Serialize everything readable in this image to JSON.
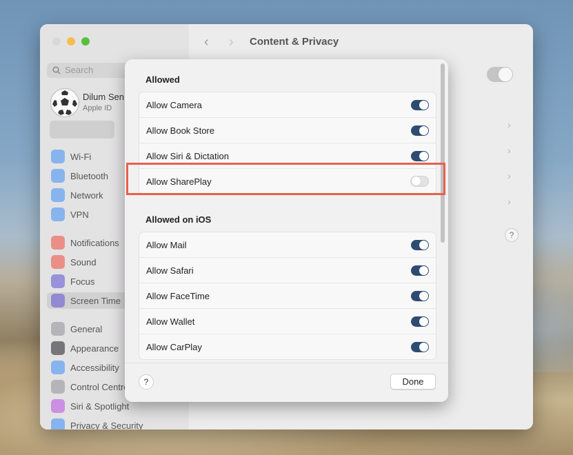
{
  "window": {
    "title": "Content & Privacy",
    "search_placeholder": "Search",
    "profile": {
      "name": "Dilum Sen",
      "subtitle": "Apple ID"
    },
    "sidebar": [
      {
        "label": "Wi-Fi",
        "icon": "wifi-icon",
        "color": "#3a8ef6"
      },
      {
        "label": "Bluetooth",
        "icon": "bluetooth-icon",
        "color": "#3a8ef6"
      },
      {
        "label": "Network",
        "icon": "globe-icon",
        "color": "#3a8ef6"
      },
      {
        "label": "VPN",
        "icon": "vpn-icon",
        "color": "#3a8ef6"
      },
      {
        "label": "Notifications",
        "icon": "bell-icon",
        "color": "#ef4a3c"
      },
      {
        "label": "Sound",
        "icon": "speaker-icon",
        "color": "#ef4a3c"
      },
      {
        "label": "Focus",
        "icon": "moon-icon",
        "color": "#5b4fcf"
      },
      {
        "label": "Screen Time",
        "icon": "hourglass-icon",
        "color": "#5b4fcf",
        "selected": true
      },
      {
        "label": "General",
        "icon": "gear-icon",
        "color": "#8e8e93"
      },
      {
        "label": "Appearance",
        "icon": "appearance-icon",
        "color": "#1c1c1e"
      },
      {
        "label": "Accessibility",
        "icon": "accessibility-icon",
        "color": "#3a8ef6"
      },
      {
        "label": "Control Centre",
        "icon": "control-centre-icon",
        "color": "#8e8e93"
      },
      {
        "label": "Siri & Spotlight",
        "icon": "siri-icon",
        "color": "#b84ce0"
      },
      {
        "label": "Privacy & Security",
        "icon": "hand-icon",
        "color": "#3a8ef6"
      }
    ]
  },
  "sheet": {
    "allowed_title": "Allowed",
    "allowed": [
      {
        "label": "Allow Camera",
        "on": true
      },
      {
        "label": "Allow Book Store",
        "on": true
      },
      {
        "label": "Allow Siri & Dictation",
        "on": true
      },
      {
        "label": "Allow SharePlay",
        "on": false
      }
    ],
    "ios_title": "Allowed on iOS",
    "ios": [
      {
        "label": "Allow Mail",
        "on": true
      },
      {
        "label": "Allow Safari",
        "on": true
      },
      {
        "label": "Allow FaceTime",
        "on": true
      },
      {
        "label": "Allow Wallet",
        "on": true
      },
      {
        "label": "Allow CarPlay",
        "on": true
      }
    ],
    "help_label": "?",
    "done_label": "Done"
  },
  "colors": {
    "toggle_on": "#2e4c71",
    "highlight": "#e8604c"
  }
}
